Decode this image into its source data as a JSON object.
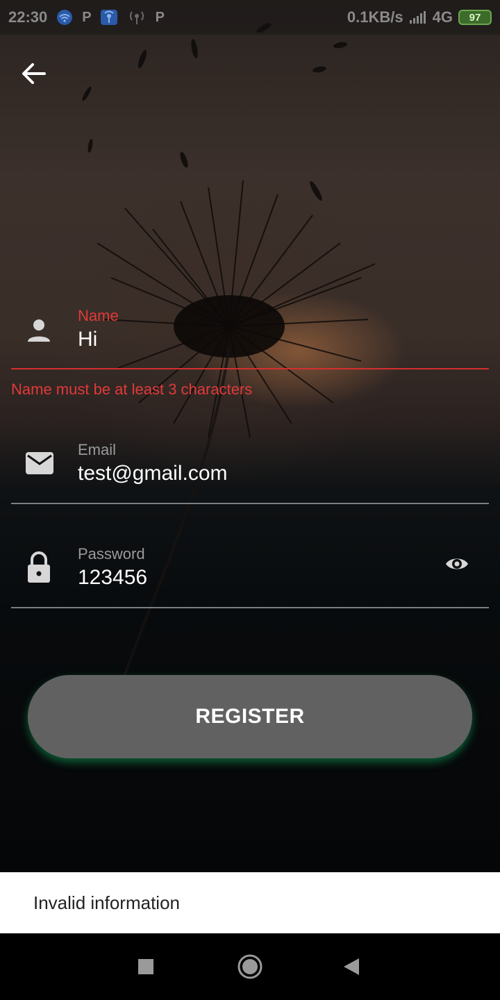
{
  "status_bar": {
    "time": "22:30",
    "left_icons": [
      "wifi-icon",
      "parking-icon",
      "hotspot-icon",
      "broadcast-icon",
      "parking-icon"
    ],
    "net_speed": "0.1KB/s",
    "network": "4G",
    "battery": "97"
  },
  "header": {
    "back_icon": "arrow-left-icon"
  },
  "form": {
    "name": {
      "label": "Name",
      "value": "Hi",
      "icon": "person-icon",
      "error": "Name must be at least 3 characters"
    },
    "email": {
      "label": "Email",
      "value": "test@gmail.com",
      "icon": "mail-icon"
    },
    "password": {
      "label": "Password",
      "value": "123456",
      "icon": "lock-icon",
      "toggle_icon": "eye-icon"
    },
    "register_label": "REGISTER"
  },
  "snackbar": {
    "message": "Invalid information"
  },
  "nav_bar": {
    "recents_icon": "square-icon",
    "home_icon": "circle-icon",
    "back_icon": "triangle-back-icon"
  },
  "colors": {
    "error": "#e03a3a",
    "button": "#616161",
    "button_glow": "#12a05a"
  }
}
